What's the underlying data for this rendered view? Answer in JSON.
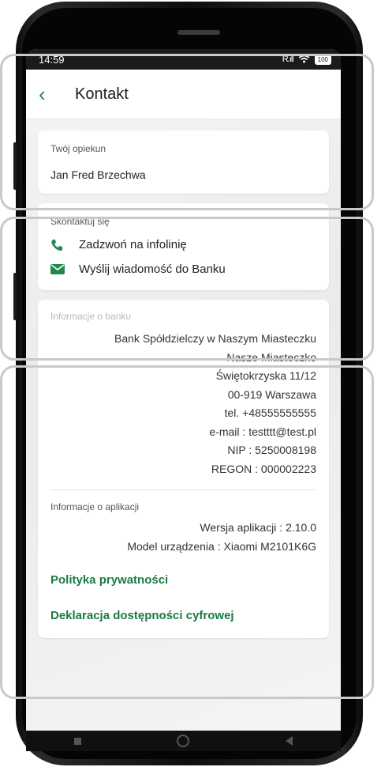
{
  "status": {
    "time": "14:59",
    "signal": "R.ıll",
    "battery": "100"
  },
  "header": {
    "back_icon": "chevron-left-icon",
    "title": "Kontakt"
  },
  "advisor": {
    "label": "Twój opiekun",
    "name": "Jan Fred Brzechwa"
  },
  "contact": {
    "label": "Skontaktuj się",
    "call": "Zadzwoń na infolinię",
    "message": "Wyślij wiadomość do Banku"
  },
  "bank": {
    "label": "Informacje o banku",
    "lines": [
      "Bank Spółdzielczy  w Naszym Miasteczku",
      "Nasze Miasteczko",
      "Świętokrzyska 11/12",
      "00-919 Warszawa",
      "tel. +48555555555",
      "e-mail : testttt@test.pl",
      "NIP : 5250008198",
      "REGON : 000002223"
    ]
  },
  "app_info": {
    "label": "Informacje o aplikacji",
    "version": "Wersja aplikacji : 2.10.0",
    "device": "Model urządzenia : Xiaomi M2101K6G"
  },
  "links": {
    "privacy": "Polityka prywatności",
    "accessibility": "Deklaracja dostępności cyfrowej"
  },
  "colors": {
    "accent": "#1f8a4c",
    "frame": "#c9c9c9"
  }
}
